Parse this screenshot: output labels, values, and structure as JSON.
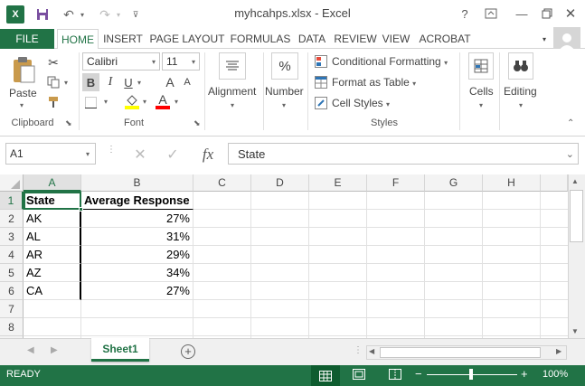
{
  "app": {
    "title": "myhcahps.xlsx - Excel",
    "help": "?",
    "colors": {
      "brand": "#217346",
      "selection": "#217346"
    }
  },
  "tabs": {
    "file": "FILE",
    "items": [
      "HOME",
      "INSERT",
      "PAGE LAYOUT",
      "FORMULAS",
      "DATA",
      "REVIEW",
      "VIEW",
      "ACROBAT"
    ]
  },
  "ribbon": {
    "clipboard": {
      "paste": "Paste",
      "label": "Clipboard"
    },
    "font": {
      "name": "Calibri",
      "size": "11",
      "bold": "B",
      "italic": "I",
      "underline": "U",
      "grow": "A",
      "shrink": "A",
      "fontcolor": "A",
      "label": "Font"
    },
    "alignment": {
      "label": "Alignment"
    },
    "number": {
      "label": "Number",
      "icon_text": "%"
    },
    "styles": {
      "conditional": "Conditional Formatting",
      "table": "Format as Table",
      "cell_styles": "Cell Styles",
      "label": "Styles"
    },
    "cells": {
      "label": "Cells"
    },
    "editing": {
      "label": "Editing"
    }
  },
  "formula_bar": {
    "name_box": "A1",
    "fx": "fx",
    "content": "State"
  },
  "columns": [
    "A",
    "B",
    "C",
    "D",
    "E",
    "F",
    "G",
    "H"
  ],
  "rows": [
    "1",
    "2",
    "3",
    "4",
    "5",
    "6",
    "7",
    "8"
  ],
  "cells": {
    "header": {
      "a": "State",
      "b": "Average Response"
    },
    "data": [
      {
        "a": "AK",
        "b": "27%"
      },
      {
        "a": "AL",
        "b": "31%"
      },
      {
        "a": "AR",
        "b": "29%"
      },
      {
        "a": "AZ",
        "b": "34%"
      },
      {
        "a": "CA",
        "b": "27%"
      }
    ]
  },
  "sheets": {
    "active": "Sheet1"
  },
  "status": {
    "mode": "READY",
    "zoom": "100%",
    "zoom_minus": "−",
    "zoom_plus": "+"
  }
}
